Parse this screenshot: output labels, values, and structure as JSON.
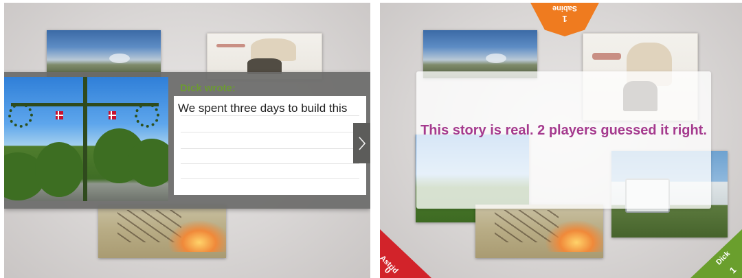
{
  "left_panel": {
    "story": {
      "author_title": "Dick wrote:",
      "text": "We spent three days to build this"
    },
    "next_icon": "chevron-right-icon"
  },
  "right_panel": {
    "result_message": "This story is real. 2 players guessed it right.",
    "players": [
      {
        "name": "Sabine",
        "score": "1",
        "color": "#ef7b1f",
        "corner": "top"
      },
      {
        "name": "Astrid",
        "score": "0",
        "color": "#d2232a",
        "corner": "bottom-left"
      },
      {
        "name": "Dick",
        "score": "1",
        "color": "#6a9f2d",
        "corner": "bottom-right"
      }
    ]
  },
  "colors": {
    "author_title": "#6c9a33",
    "result_text": "#a53a8e",
    "overlay_gray": "#6c6c6a"
  }
}
